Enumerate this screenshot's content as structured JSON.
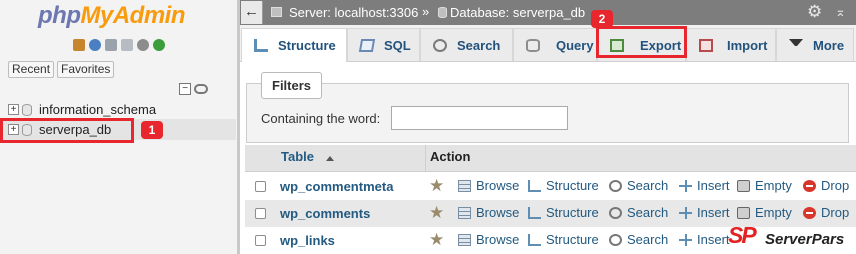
{
  "sidebar": {
    "logo": {
      "part1": "php",
      "part2": "MyAdmin"
    },
    "quick_icons": [
      "home-icon",
      "help-icon",
      "docs-icon",
      "sql-icon",
      "settings-icon",
      "reload-icon"
    ],
    "tabs": [
      {
        "label": "Recent"
      },
      {
        "label": "Favorites"
      }
    ],
    "collapse_symbol": "−",
    "databases": [
      {
        "name": "information_schema",
        "expander": "+"
      },
      {
        "name": "serverpa_db",
        "expander": "+"
      }
    ]
  },
  "annotations": {
    "marker_1": "1",
    "marker_2": "2",
    "color": "#e8262d"
  },
  "breadcrumb": {
    "back_symbol": "←",
    "server": "Server: localhost:3306",
    "separator": "»",
    "database": "Database: serverpa_db",
    "gear_symbol": "⚙",
    "minimize_symbol": "⌅"
  },
  "tabs": [
    {
      "label": "Structure",
      "icon": "structure-icon",
      "active": true
    },
    {
      "label": "SQL",
      "icon": "sql-icon"
    },
    {
      "label": "Search",
      "icon": "search-icon"
    },
    {
      "label": "Query",
      "icon": "query-icon"
    },
    {
      "label": "Export",
      "icon": "export-icon"
    },
    {
      "label": "Import",
      "icon": "import-icon"
    },
    {
      "label": "More",
      "icon": "chevron-down-icon"
    }
  ],
  "filters": {
    "legend": "Filters",
    "label": "Containing the word:",
    "value": ""
  },
  "table": {
    "columns": {
      "table": "Table",
      "action": "Action"
    },
    "star_symbol": "★",
    "actions": [
      "Browse",
      "Structure",
      "Search",
      "Insert",
      "Empty",
      "Drop"
    ],
    "rows": [
      {
        "name": "wp_commentmeta"
      },
      {
        "name": "wp_comments"
      },
      {
        "name": "wp_links"
      }
    ]
  },
  "watermark": {
    "mark": "SP",
    "text": "ServerPars"
  },
  "colors": {
    "link": "#235a81",
    "accent": "#e8262d",
    "topbar": "#7d7d7d"
  }
}
